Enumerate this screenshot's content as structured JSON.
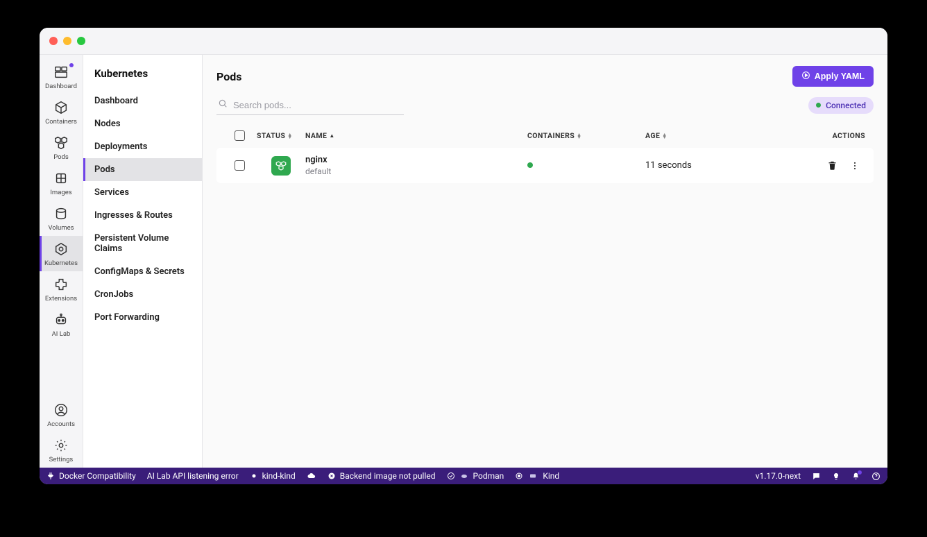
{
  "rail": {
    "items": [
      {
        "id": "dashboard",
        "label": "Dashboard",
        "icon": "dashboard-icon",
        "notif": true
      },
      {
        "id": "containers",
        "label": "Containers",
        "icon": "cube-icon"
      },
      {
        "id": "pods",
        "label": "Pods",
        "icon": "pods-icon"
      },
      {
        "id": "images",
        "label": "Images",
        "icon": "layers-icon"
      },
      {
        "id": "volumes",
        "label": "Volumes",
        "icon": "cylinder-icon"
      },
      {
        "id": "kubernetes",
        "label": "Kubernetes",
        "icon": "kubernetes-icon",
        "active": true
      },
      {
        "id": "extensions",
        "label": "Extensions",
        "icon": "puzzle-icon"
      },
      {
        "id": "ailab",
        "label": "AI Lab",
        "icon": "robot-icon"
      }
    ],
    "bottom": [
      {
        "id": "accounts",
        "label": "Accounts",
        "icon": "user-circle-icon"
      },
      {
        "id": "settings",
        "label": "Settings",
        "icon": "gear-icon"
      }
    ]
  },
  "sidebar": {
    "title": "Kubernetes",
    "items": [
      {
        "label": "Dashboard"
      },
      {
        "label": "Nodes"
      },
      {
        "label": "Deployments"
      },
      {
        "label": "Pods",
        "active": true
      },
      {
        "label": "Services"
      },
      {
        "label": "Ingresses & Routes"
      },
      {
        "label": "Persistent Volume Claims"
      },
      {
        "label": "ConfigMaps & Secrets"
      },
      {
        "label": "CronJobs"
      },
      {
        "label": "Port Forwarding"
      }
    ]
  },
  "page": {
    "title": "Pods",
    "apply_label": "Apply YAML",
    "search_placeholder": "Search pods...",
    "connected_label": "Connected"
  },
  "table": {
    "headers": {
      "status": "STATUS",
      "name": "NAME",
      "containers": "CONTAINERS",
      "age": "AGE",
      "actions": "ACTIONS"
    },
    "rows": [
      {
        "name": "nginx",
        "namespace": "default",
        "age": "11 seconds"
      }
    ]
  },
  "statusbar": {
    "items": [
      {
        "icon": "plug-icon",
        "label": "Docker Compatibility"
      },
      {
        "icon": "",
        "label": "AI Lab API listening error"
      },
      {
        "icon": "cloud-small-icon",
        "label": "kind-kind"
      },
      {
        "icon": "cloud-icon",
        "label": ""
      },
      {
        "icon": "x-circle-icon",
        "label": "Backend image not pulled"
      },
      {
        "icon": "check-circle-icon",
        "label": "Podman",
        "prefix": "seal-icon"
      },
      {
        "icon": "record-icon",
        "label": "Kind",
        "prefix": "cube-small-icon"
      }
    ],
    "version": "v1.17.0-next"
  }
}
